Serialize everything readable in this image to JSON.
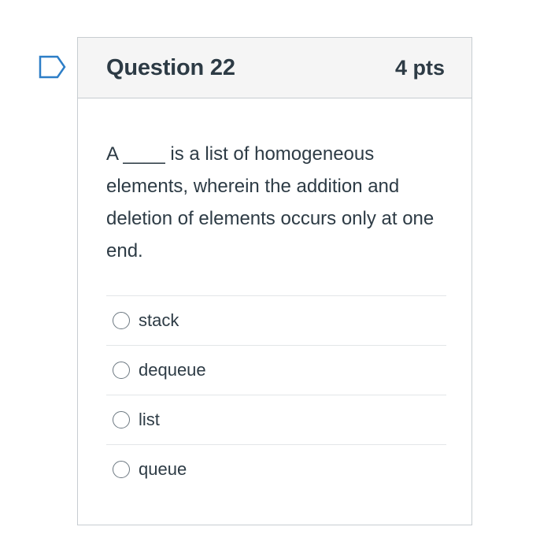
{
  "question": {
    "title": "Question 22",
    "points": "4 pts",
    "text": "A ____ is a list of homogeneous elements, wherein the addition and deletion of elements occurs only at one end.",
    "flag_icon": "flag-icon"
  },
  "answers": [
    {
      "label": "stack",
      "selected": false
    },
    {
      "label": "dequeue",
      "selected": false
    },
    {
      "label": "list",
      "selected": false
    },
    {
      "label": "queue",
      "selected": false
    }
  ],
  "colors": {
    "text": "#2d3b45",
    "border": "#c7cdd1",
    "header_bg": "#f5f5f5",
    "flag": "#2d7ec7"
  }
}
